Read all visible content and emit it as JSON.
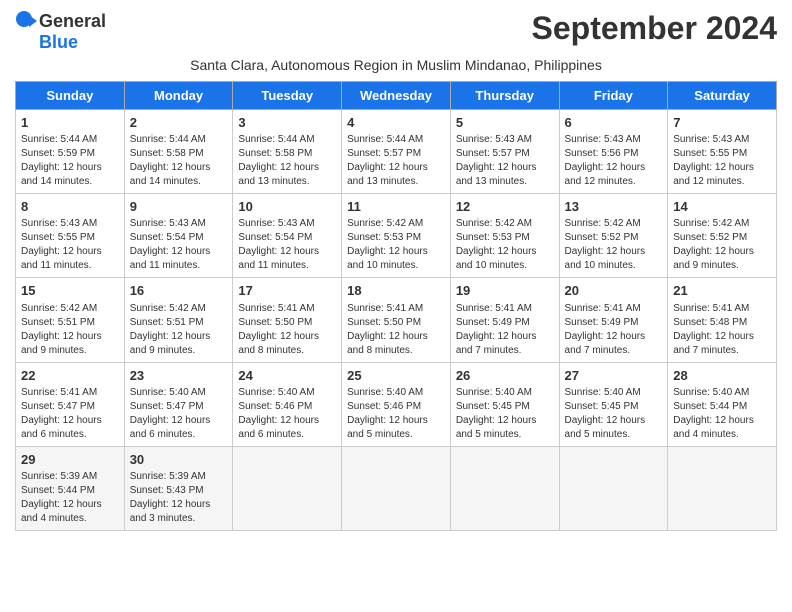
{
  "logo": {
    "line1": "General",
    "line2": "Blue"
  },
  "title": "September 2024",
  "subtitle": "Santa Clara, Autonomous Region in Muslim Mindanao, Philippines",
  "days_header": [
    "Sunday",
    "Monday",
    "Tuesday",
    "Wednesday",
    "Thursday",
    "Friday",
    "Saturday"
  ],
  "weeks": [
    [
      {
        "day": "1",
        "lines": [
          "Sunrise: 5:44 AM",
          "Sunset: 5:59 PM",
          "Daylight: 12 hours",
          "and 14 minutes."
        ]
      },
      {
        "day": "2",
        "lines": [
          "Sunrise: 5:44 AM",
          "Sunset: 5:58 PM",
          "Daylight: 12 hours",
          "and 14 minutes."
        ]
      },
      {
        "day": "3",
        "lines": [
          "Sunrise: 5:44 AM",
          "Sunset: 5:58 PM",
          "Daylight: 12 hours",
          "and 13 minutes."
        ]
      },
      {
        "day": "4",
        "lines": [
          "Sunrise: 5:44 AM",
          "Sunset: 5:57 PM",
          "Daylight: 12 hours",
          "and 13 minutes."
        ]
      },
      {
        "day": "5",
        "lines": [
          "Sunrise: 5:43 AM",
          "Sunset: 5:57 PM",
          "Daylight: 12 hours",
          "and 13 minutes."
        ]
      },
      {
        "day": "6",
        "lines": [
          "Sunrise: 5:43 AM",
          "Sunset: 5:56 PM",
          "Daylight: 12 hours",
          "and 12 minutes."
        ]
      },
      {
        "day": "7",
        "lines": [
          "Sunrise: 5:43 AM",
          "Sunset: 5:55 PM",
          "Daylight: 12 hours",
          "and 12 minutes."
        ]
      }
    ],
    [
      {
        "day": "8",
        "lines": [
          "Sunrise: 5:43 AM",
          "Sunset: 5:55 PM",
          "Daylight: 12 hours",
          "and 11 minutes."
        ]
      },
      {
        "day": "9",
        "lines": [
          "Sunrise: 5:43 AM",
          "Sunset: 5:54 PM",
          "Daylight: 12 hours",
          "and 11 minutes."
        ]
      },
      {
        "day": "10",
        "lines": [
          "Sunrise: 5:43 AM",
          "Sunset: 5:54 PM",
          "Daylight: 12 hours",
          "and 11 minutes."
        ]
      },
      {
        "day": "11",
        "lines": [
          "Sunrise: 5:42 AM",
          "Sunset: 5:53 PM",
          "Daylight: 12 hours",
          "and 10 minutes."
        ]
      },
      {
        "day": "12",
        "lines": [
          "Sunrise: 5:42 AM",
          "Sunset: 5:53 PM",
          "Daylight: 12 hours",
          "and 10 minutes."
        ]
      },
      {
        "day": "13",
        "lines": [
          "Sunrise: 5:42 AM",
          "Sunset: 5:52 PM",
          "Daylight: 12 hours",
          "and 10 minutes."
        ]
      },
      {
        "day": "14",
        "lines": [
          "Sunrise: 5:42 AM",
          "Sunset: 5:52 PM",
          "Daylight: 12 hours",
          "and 9 minutes."
        ]
      }
    ],
    [
      {
        "day": "15",
        "lines": [
          "Sunrise: 5:42 AM",
          "Sunset: 5:51 PM",
          "Daylight: 12 hours",
          "and 9 minutes."
        ]
      },
      {
        "day": "16",
        "lines": [
          "Sunrise: 5:42 AM",
          "Sunset: 5:51 PM",
          "Daylight: 12 hours",
          "and 9 minutes."
        ]
      },
      {
        "day": "17",
        "lines": [
          "Sunrise: 5:41 AM",
          "Sunset: 5:50 PM",
          "Daylight: 12 hours",
          "and 8 minutes."
        ]
      },
      {
        "day": "18",
        "lines": [
          "Sunrise: 5:41 AM",
          "Sunset: 5:50 PM",
          "Daylight: 12 hours",
          "and 8 minutes."
        ]
      },
      {
        "day": "19",
        "lines": [
          "Sunrise: 5:41 AM",
          "Sunset: 5:49 PM",
          "Daylight: 12 hours",
          "and 7 minutes."
        ]
      },
      {
        "day": "20",
        "lines": [
          "Sunrise: 5:41 AM",
          "Sunset: 5:49 PM",
          "Daylight: 12 hours",
          "and 7 minutes."
        ]
      },
      {
        "day": "21",
        "lines": [
          "Sunrise: 5:41 AM",
          "Sunset: 5:48 PM",
          "Daylight: 12 hours",
          "and 7 minutes."
        ]
      }
    ],
    [
      {
        "day": "22",
        "lines": [
          "Sunrise: 5:41 AM",
          "Sunset: 5:47 PM",
          "Daylight: 12 hours",
          "and 6 minutes."
        ]
      },
      {
        "day": "23",
        "lines": [
          "Sunrise: 5:40 AM",
          "Sunset: 5:47 PM",
          "Daylight: 12 hours",
          "and 6 minutes."
        ]
      },
      {
        "day": "24",
        "lines": [
          "Sunrise: 5:40 AM",
          "Sunset: 5:46 PM",
          "Daylight: 12 hours",
          "and 6 minutes."
        ]
      },
      {
        "day": "25",
        "lines": [
          "Sunrise: 5:40 AM",
          "Sunset: 5:46 PM",
          "Daylight: 12 hours",
          "and 5 minutes."
        ]
      },
      {
        "day": "26",
        "lines": [
          "Sunrise: 5:40 AM",
          "Sunset: 5:45 PM",
          "Daylight: 12 hours",
          "and 5 minutes."
        ]
      },
      {
        "day": "27",
        "lines": [
          "Sunrise: 5:40 AM",
          "Sunset: 5:45 PM",
          "Daylight: 12 hours",
          "and 5 minutes."
        ]
      },
      {
        "day": "28",
        "lines": [
          "Sunrise: 5:40 AM",
          "Sunset: 5:44 PM",
          "Daylight: 12 hours",
          "and 4 minutes."
        ]
      }
    ],
    [
      {
        "day": "29",
        "lines": [
          "Sunrise: 5:39 AM",
          "Sunset: 5:44 PM",
          "Daylight: 12 hours",
          "and 4 minutes."
        ]
      },
      {
        "day": "30",
        "lines": [
          "Sunrise: 5:39 AM",
          "Sunset: 5:43 PM",
          "Daylight: 12 hours",
          "and 3 minutes."
        ]
      },
      {
        "day": "",
        "lines": []
      },
      {
        "day": "",
        "lines": []
      },
      {
        "day": "",
        "lines": []
      },
      {
        "day": "",
        "lines": []
      },
      {
        "day": "",
        "lines": []
      }
    ]
  ]
}
